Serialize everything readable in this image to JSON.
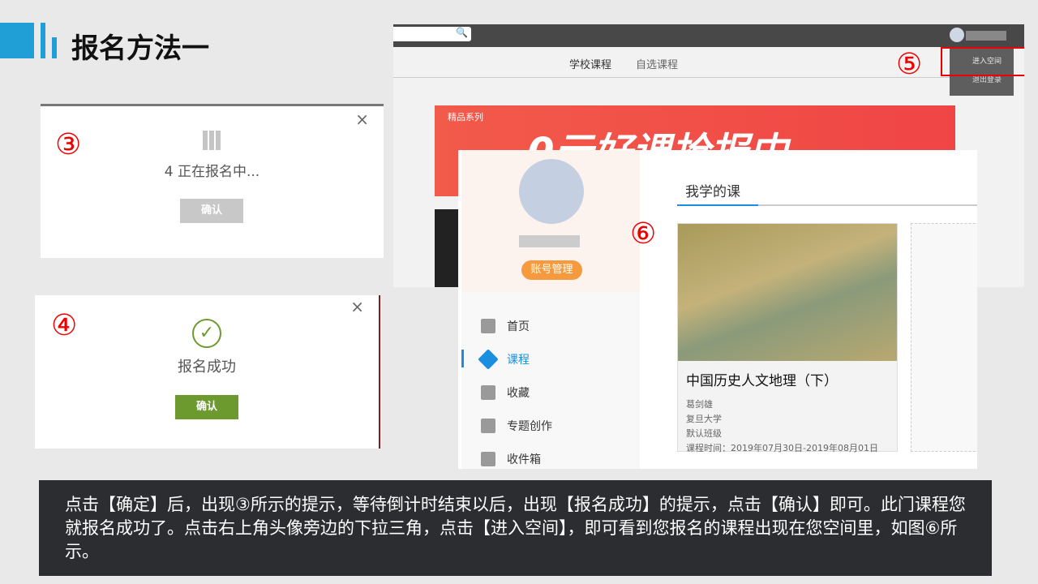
{
  "slide": {
    "title": "报名方法一",
    "caption": "点击【确定】后，出现③所示的提示，等待倒计时结束以后，出现【报名成功】的提示，点击【确认】即可。此门课程您就报名成功了。点击右上角头像旁边的下拉三角，点击【进入空间】，即可看到您报名的课程出现在您空间里，如图⑥所示。"
  },
  "markers": {
    "m3": "③",
    "m4": "④",
    "m5": "⑤",
    "m6": "⑥"
  },
  "dialog3": {
    "message": "4 正在报名中...",
    "confirm": "确认",
    "close": "×"
  },
  "dialog4": {
    "message": "报名成功",
    "confirm": "确认",
    "close": "×"
  },
  "site": {
    "tabs": [
      "学校课程",
      "自选课程"
    ],
    "menu": [
      "进入空间",
      "退出登录"
    ],
    "banner_tag": "精品系列",
    "banner_text": "0元好课抢报中"
  },
  "space": {
    "account_btn": "账号管理",
    "nav": [
      "首页",
      "课程",
      "收藏",
      "专题创作",
      "收件箱"
    ],
    "tab": "我学的课",
    "course": {
      "title": "中国历史人文地理（下）",
      "teacher": "葛剑雄",
      "school": "复旦大学",
      "class": "默认班级",
      "time": "课程时间：2019年07月30日-2019年08月01日"
    }
  },
  "colors": {
    "accent": "#1a9ad6",
    "green": "#6d9a2e",
    "red": "#e00000"
  }
}
